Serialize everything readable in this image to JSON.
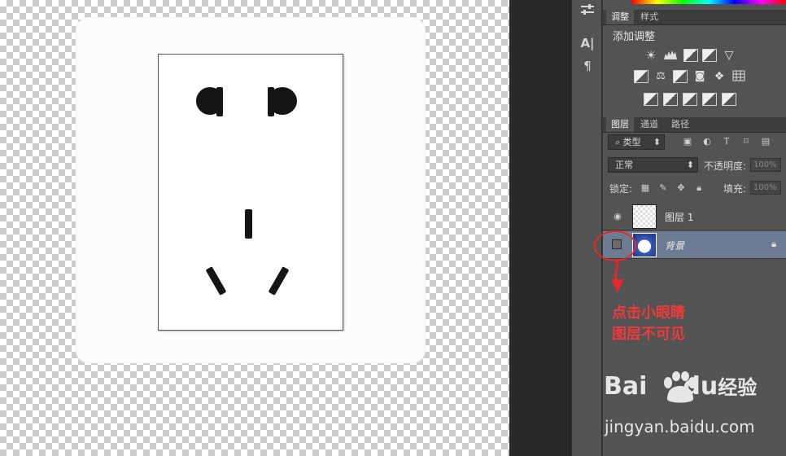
{
  "adjust_panel": {
    "tabs": [
      "调整",
      "样式"
    ],
    "title": "添加调整"
  },
  "layers_panel": {
    "tabs": [
      "图层",
      "通道",
      "路径"
    ],
    "filter_kind": "类型",
    "blend_mode": "正常",
    "opacity_label": "不透明度:",
    "opacity_value": "100%",
    "lock_label": "锁定:",
    "fill_label": "填充:",
    "fill_value": "100%",
    "layers": [
      {
        "name": "图层 1",
        "visible": true
      },
      {
        "name": "背景",
        "visible": false,
        "locked": true,
        "selected": true
      }
    ]
  },
  "annotation": {
    "line1": "点击小眼睛",
    "line2": "图层不可见",
    "color": "#e8272a"
  },
  "watermark": {
    "brand": "Bai",
    "brand2": "du",
    "brand_cn": "经验",
    "url": "jingyan.baidu.com"
  }
}
